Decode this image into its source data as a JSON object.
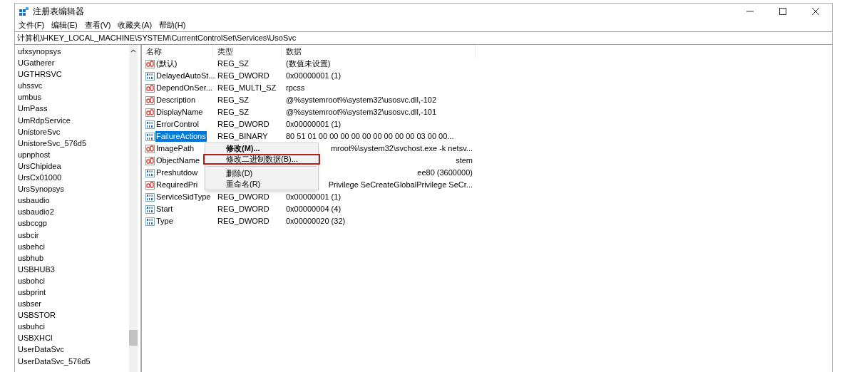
{
  "window": {
    "title": "注册表编辑器"
  },
  "menu_bar": [
    "文件(F)",
    "编辑(E)",
    "查看(V)",
    "收藏夹(A)",
    "帮助(H)"
  ],
  "address_bar": "计算机\\HKEY_LOCAL_MACHINE\\SYSTEM\\CurrentControlSet\\Services\\UsoSvc",
  "tree": {
    "items": [
      "ufxsynopsys",
      "UGatherer",
      "UGTHRSVC",
      "uhssvc",
      "umbus",
      "UmPass",
      "UmRdpService",
      "UnistoreSvc",
      "UnistoreSvc_576d5",
      "upnphost",
      "UrsChipidea",
      "UrsCx01000",
      "UrsSynopsys",
      "usbaudio",
      "usbaudio2",
      "usbccgp",
      "usbcir",
      "usbehci",
      "usbhub",
      "USBHUB3",
      "usbohci",
      "usbprint",
      "usbser",
      "USBSTOR",
      "usbuhci",
      "USBXHCI",
      "UserDataSvc",
      "UserDataSvc_576d5"
    ]
  },
  "table": {
    "columns": [
      "名称",
      "类型",
      "数据"
    ],
    "rows": [
      {
        "kind": "string",
        "name": "(默认)",
        "type": "REG_SZ",
        "data": "(数值未设置)",
        "selected": false,
        "covered": false
      },
      {
        "kind": "binary",
        "name": "DelayedAutoSt...",
        "type": "REG_DWORD",
        "data": "0x00000001 (1)",
        "selected": false,
        "covered": false
      },
      {
        "kind": "string",
        "name": "DependOnSer...",
        "type": "REG_MULTI_SZ",
        "data": "rpcss",
        "selected": false,
        "covered": false
      },
      {
        "kind": "string",
        "name": "Description",
        "type": "REG_SZ",
        "data": "@%systemroot%\\system32\\usosvc.dll,-102",
        "selected": false,
        "covered": false
      },
      {
        "kind": "string",
        "name": "DisplayName",
        "type": "REG_SZ",
        "data": "@%systemroot%\\system32\\usosvc.dll,-101",
        "selected": false,
        "covered": false
      },
      {
        "kind": "binary",
        "name": "ErrorControl",
        "type": "REG_DWORD",
        "data": "0x00000001 (1)",
        "selected": false,
        "covered": false
      },
      {
        "kind": "binary",
        "name": "FailureActions",
        "type": "REG_BINARY",
        "data": "80 51 01 00 00 00 00 00 00 00 00 00 03 00 00...",
        "selected": true,
        "covered": false
      },
      {
        "kind": "string",
        "name": "ImagePath",
        "data": "mroot%\\system32\\svchost.exe -k netsv...",
        "selected": false,
        "covered": true
      },
      {
        "kind": "string",
        "name": "ObjectName",
        "data": "stem",
        "selected": false,
        "covered": true
      },
      {
        "kind": "binary",
        "name": "Preshutdow",
        "data": "ee80 (3600000)",
        "selected": false,
        "covered": true
      },
      {
        "kind": "string",
        "name": "RequiredPri",
        "data": "Privilege SeCreateGlobalPrivilege SeCr...",
        "selected": false,
        "covered": true
      },
      {
        "kind": "binary",
        "name": "ServiceSidType",
        "type": "REG_DWORD",
        "data": "0x00000001 (1)",
        "selected": false,
        "covered": false
      },
      {
        "kind": "binary",
        "name": "Start",
        "type": "REG_DWORD",
        "data": "0x00000004 (4)",
        "selected": false,
        "covered": false
      },
      {
        "kind": "binary",
        "name": "Type",
        "type": "REG_DWORD",
        "data": "0x00000020 (32)",
        "selected": false,
        "covered": false
      }
    ]
  },
  "context_menu": {
    "items": [
      {
        "kind": "item",
        "label": "修改(M)...",
        "bold": true,
        "selected": false
      },
      {
        "kind": "item",
        "label": "修改二进制数据(B)...",
        "bold": false,
        "selected": true
      },
      {
        "kind": "separator"
      },
      {
        "kind": "item",
        "label": "删除(D)",
        "bold": false,
        "selected": false
      },
      {
        "kind": "item",
        "label": "重命名(R)",
        "bold": false,
        "selected": false
      }
    ]
  }
}
